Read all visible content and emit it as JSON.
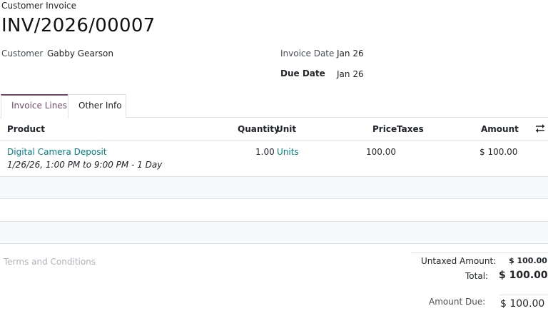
{
  "header": {
    "doc_type": "Customer Invoice",
    "number": "INV/2026/00007"
  },
  "form": {
    "customer_label": "Customer",
    "customer_value": "Gabby Gearson",
    "invoice_date_label": "Invoice Date",
    "invoice_date_value": "Jan 26",
    "due_date_label": "Due Date",
    "due_date_value": "Jan 26"
  },
  "tabs": [
    {
      "label": "Invoice Lines",
      "active": true
    },
    {
      "label": "Other Info",
      "active": false
    }
  ],
  "table": {
    "columns": {
      "product": "Product",
      "quantity": "Quantity",
      "unit": "Unit",
      "price": "Price",
      "taxes": "Taxes",
      "amount": "Amount"
    },
    "rows": [
      {
        "product": "Digital Camera Deposit",
        "description": "1/26/26, 1:00 PM to 9:00 PM - 1 Day",
        "quantity": "1.00",
        "unit": "Units",
        "price": "100.00",
        "taxes": "",
        "amount": "$ 100.00"
      }
    ]
  },
  "footer": {
    "terms_placeholder": "Terms and Conditions",
    "untaxed_label": "Untaxed Amount:",
    "untaxed_value": "$ 100.00",
    "total_label": "Total:",
    "total_value": "$ 100.00",
    "due_label": "Amount Due:",
    "due_value": "$ 100.00"
  },
  "colors": {
    "link": "#017e84",
    "tab_accent": "#714b67"
  }
}
